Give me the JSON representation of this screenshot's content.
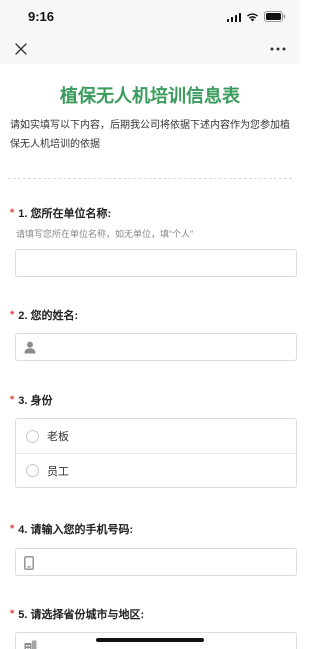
{
  "status_bar": {
    "time": "9:16"
  },
  "nav": {
    "close_icon": "close-icon",
    "more_icon": "more-dots-icon"
  },
  "form": {
    "title": "植保无人机培训信息表",
    "intro": "请如实填写以下内容，后期我公司将依据下述内容作为您参加植保无人机培训的依据",
    "required_mark": "*",
    "questions": [
      {
        "label": "1. 您所在单位名称:",
        "hint": "请填写您所在单位名称，如无单位，填“个人”",
        "type": "text",
        "value": ""
      },
      {
        "label": "2. 您的姓名:",
        "type": "text",
        "icon": "person-icon",
        "value": ""
      },
      {
        "label": "3. 身份",
        "type": "radio",
        "options": [
          "老板",
          "员工"
        ]
      },
      {
        "label": "4. 请输入您的手机号码:",
        "type": "text",
        "icon": "phone-icon",
        "value": ""
      },
      {
        "label": "5. 请选择省份城市与地区:",
        "type": "select",
        "icon": "building-icon",
        "value": ""
      }
    ]
  },
  "colors": {
    "title_green": "#3a9b5c",
    "required_red": "#e64340"
  }
}
